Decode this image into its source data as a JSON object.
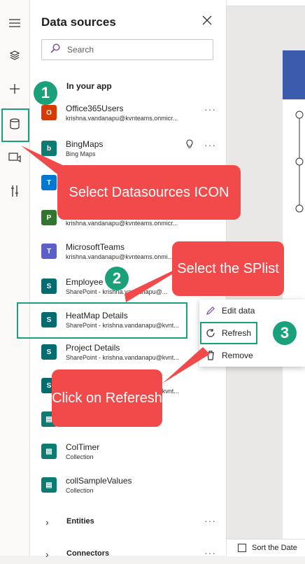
{
  "panel": {
    "title": "Data sources"
  },
  "search": {
    "placeholder": "Search"
  },
  "section": {
    "label": "In your app"
  },
  "items": [
    {
      "name": "Office365Users",
      "sub": "krishna.vandanapu@kvnteams.onmicr...",
      "icon": "office365-icon",
      "color": "#d83b01"
    },
    {
      "name": "BingMaps",
      "sub": "Bing Maps",
      "icon": "bing-icon",
      "color": "#0e7a72"
    },
    {
      "name": "",
      "sub": "",
      "icon": "teams-icon",
      "color": "#0078d4"
    },
    {
      "name": "",
      "sub": "krishna.vandanapu@kvnteams.onmicr...",
      "icon": "planner-icon",
      "color": "#31752f"
    },
    {
      "name": "MicrosoftTeams",
      "sub": "krishna.vandanapu@kvnteams.onmi...",
      "icon": "teams-icon",
      "color": "#5b5fc7"
    },
    {
      "name": "Employee",
      "sub": "SharePoint - krishna.vandanapu@...",
      "icon": "sharepoint-icon",
      "color": "#036c70"
    },
    {
      "name": "HeatMap Details",
      "sub": "SharePoint - krishna.vandanapu@kvnt...",
      "icon": "sharepoint-icon",
      "color": "#036c70"
    },
    {
      "name": "Project Details",
      "sub": "SharePoint - krishna.vandanapu@kvnt...",
      "icon": "sharepoint-icon",
      "color": "#036c70"
    },
    {
      "name": "",
      "sub": "SharePoint - krishna.vandanapu@kvnt...",
      "icon": "sharepoint-icon",
      "color": "#036c70"
    },
    {
      "name": "",
      "sub": "",
      "icon": "collection-icon",
      "color": "#0e7a72"
    },
    {
      "name": "ColTimer",
      "sub": "Collection",
      "icon": "collection-icon",
      "color": "#0e7a72"
    },
    {
      "name": "collSampleValues",
      "sub": "Collection",
      "icon": "collection-icon",
      "color": "#0e7a72"
    }
  ],
  "groups": [
    {
      "label": "Entities"
    },
    {
      "label": "Connectors"
    }
  ],
  "context_menu": {
    "edit": "Edit data",
    "refresh": "Refresh",
    "remove": "Remove"
  },
  "callouts": {
    "select_icon": "Select Datasources ICON",
    "select_list": "Select the SPlist",
    "click_refresh": "Click on Referesh"
  },
  "steps": [
    "1",
    "2",
    "3"
  ],
  "canvas": {
    "sort_label": "Sort the Date"
  },
  "more_label": "···",
  "colors": {
    "accent_green": "#1aa07a",
    "callout_red": "#f24a4a",
    "sharepoint": "#036c70",
    "app_header": "#3b5bad"
  }
}
